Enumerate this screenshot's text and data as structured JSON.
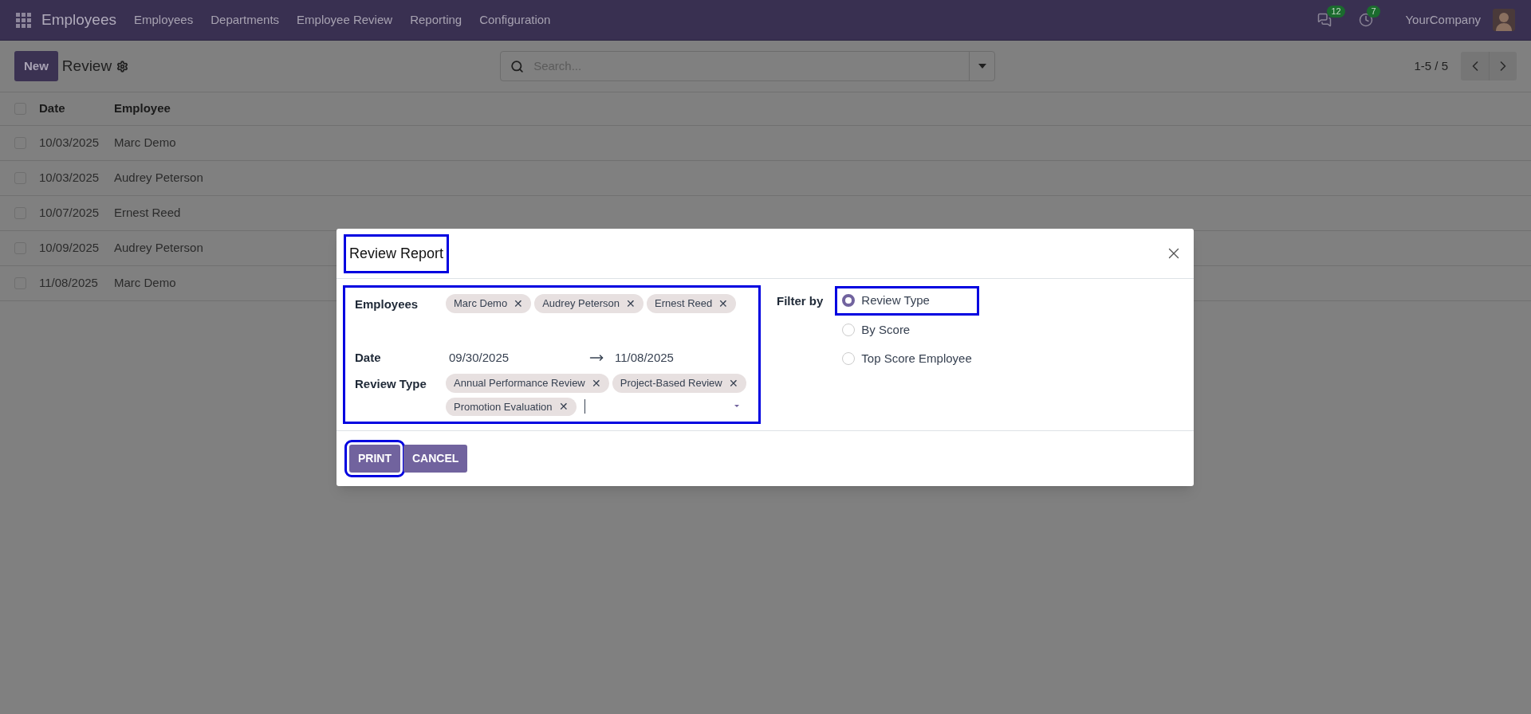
{
  "navbar": {
    "app_title": "Employees",
    "menu": [
      "Employees",
      "Departments",
      "Employee Review",
      "Reporting",
      "Configuration"
    ],
    "messages_count": "12",
    "activities_count": "7",
    "company": "YourCompany"
  },
  "control_panel": {
    "new_button": "New",
    "title": "Review",
    "search": {
      "placeholder": "Search..."
    },
    "pager": "1-5 / 5"
  },
  "table": {
    "columns": [
      "Date",
      "Employee"
    ],
    "all_checked": false,
    "rows": [
      {
        "date": "10/03/2025",
        "employee": "Marc Demo",
        "checked": false
      },
      {
        "date": "10/03/2025",
        "employee": "Audrey Peterson",
        "checked": false
      },
      {
        "date": "10/07/2025",
        "employee": "Ernest Reed",
        "checked": false
      },
      {
        "date": "10/09/2025",
        "employee": "Audrey Peterson",
        "checked": false
      },
      {
        "date": "11/08/2025",
        "employee": "Marc Demo",
        "checked": false
      }
    ]
  },
  "dialog": {
    "title": {
      "text": "Review Report",
      "highlighted": true
    },
    "fields_highlighted": true,
    "fields": [
      {
        "kind": "tags",
        "label": "Employees",
        "tags": [
          "Marc Demo",
          "Audrey Peterson",
          "Ernest Reed"
        ],
        "remove_mark": "✕"
      },
      {
        "kind": "daterange",
        "label": "Date",
        "start": "09/30/2025",
        "end": "11/08/2025"
      },
      {
        "kind": "tags",
        "label": "Review Type",
        "tags": [
          "Annual Performance Review",
          "Project-Based Review",
          "Promotion Evaluation"
        ],
        "remove_mark": "✕",
        "input": true
      }
    ],
    "filter": {
      "label": "Filter by",
      "options": [
        {
          "label": "Review Type",
          "selected": true,
          "highlighted": true
        },
        {
          "label": "By Score",
          "selected": false,
          "highlighted": false
        },
        {
          "label": "Top Score Employee",
          "selected": false,
          "highlighted": false
        }
      ]
    },
    "buttons": [
      {
        "label": "PRINT",
        "highlighted": true
      },
      {
        "label": "CANCEL",
        "highlighted": false
      }
    ]
  }
}
